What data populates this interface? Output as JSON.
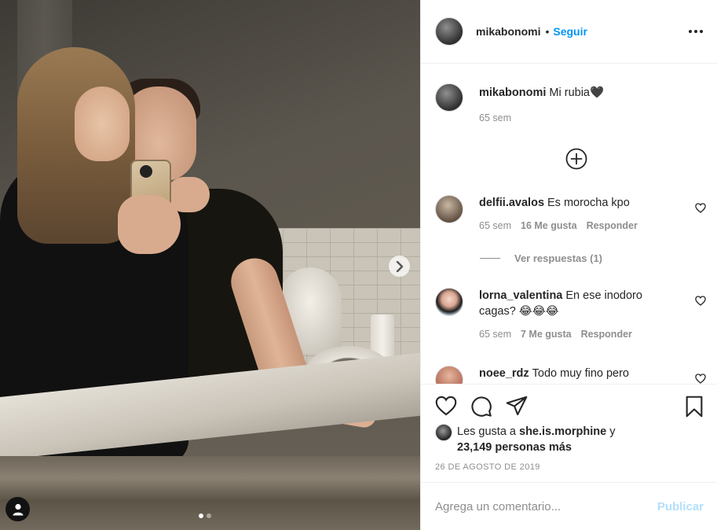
{
  "post": {
    "image_alt": "Selfie en el espejo del baño",
    "carousel": {
      "count": 2,
      "active": 1
    }
  },
  "header": {
    "username": "mikabonomi",
    "separator": "•",
    "follow_label": "Seguir"
  },
  "caption": {
    "username": "mikabonomi",
    "text": "Mi rubia🖤",
    "time": "65 sem"
  },
  "comments": [
    {
      "username": "delfii.avalos",
      "text": "Es morocha kpo",
      "time": "65 sem",
      "likes": "16 Me gusta",
      "reply_label": "Responder",
      "view_replies": "Ver respuestas (1)"
    },
    {
      "username": "lorna_valentina",
      "text": "En ese inodoro cagas? 😂😂😂",
      "time": "65 sem",
      "likes": "7 Me gusta",
      "reply_label": "Responder"
    },
    {
      "username": "noee_rdz",
      "text": "Todo muy fino pero"
    }
  ],
  "likes": {
    "prefix": "Les gusta a",
    "user": "she.is.morphine",
    "conj": "y",
    "others": "23,149 personas más"
  },
  "date": "26 DE AGOSTO DE 2019",
  "add_comment": {
    "placeholder": "Agrega un comentario...",
    "publish_label": "Publicar"
  },
  "colors": {
    "link": "#0095f6",
    "publish_disabled": "#b2dffc",
    "muted": "#8e8e8e",
    "text": "#262626"
  },
  "icons": [
    "user-tag-icon",
    "chevron-right-icon",
    "more-options-icon",
    "add-icon",
    "heart-icon",
    "comment-icon",
    "share-icon",
    "bookmark-icon"
  ]
}
